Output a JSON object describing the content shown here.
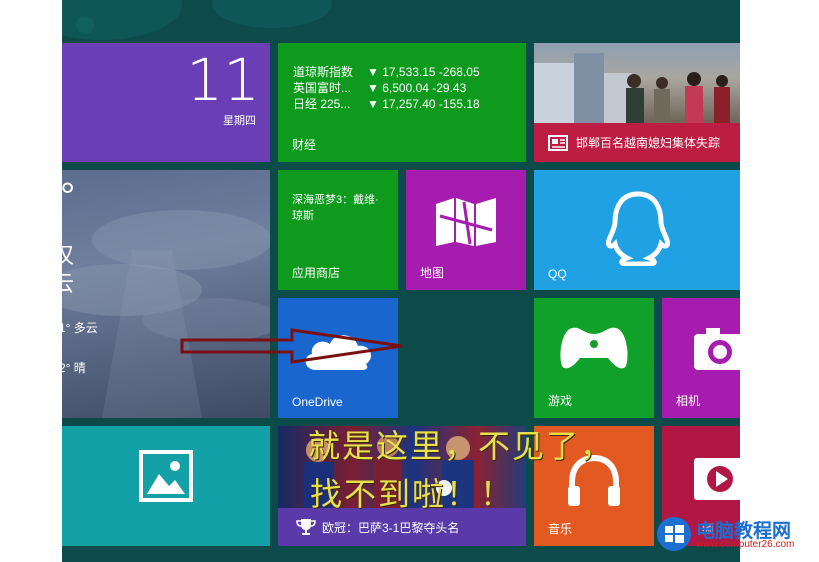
{
  "calendar": {
    "day": "11",
    "weekday": "星期四"
  },
  "finance": {
    "label": "财经",
    "rows": [
      {
        "name": "道琼斯指数",
        "value": "▼ 17,533.15 -268.05"
      },
      {
        "name": "英国富时...",
        "value": "▼ 6,500.04 -29.43"
      },
      {
        "name": "日经 225...",
        "value": "▼ 17,257.40 -155.18"
      }
    ]
  },
  "news": {
    "headline": "邯郸百名越南媳妇集体失踪"
  },
  "weather": {
    "temp_fragment": "°",
    "city_fragment": "汉",
    "condition_fragment": "云",
    "forecast": [
      {
        "text": "1° 多云"
      },
      {
        "text": "2° 晴"
      }
    ]
  },
  "store": {
    "app_title": "深海恶梦3：戴维·琼斯",
    "label": "应用商店"
  },
  "maps": {
    "label": "地图"
  },
  "qq": {
    "label": "QQ"
  },
  "onedrive": {
    "label": "OneDrive"
  },
  "games": {
    "label": "游戏"
  },
  "camera": {
    "label": "相机"
  },
  "sport": {
    "headline": "欧冠：巴萨3-1巴黎夺头名"
  },
  "music": {
    "label": "音乐"
  },
  "video": {
    "label": "频"
  },
  "annotation": {
    "line1": "就是这里，不见了，",
    "line2": "找不到啦！！"
  },
  "watermark": {
    "title": "电脑教程网",
    "url": "www.computer26.com"
  },
  "colors": {
    "background": "#0d4a4a",
    "accent_arrow": "#7a1010",
    "annotation_text": "#e8e04a"
  }
}
